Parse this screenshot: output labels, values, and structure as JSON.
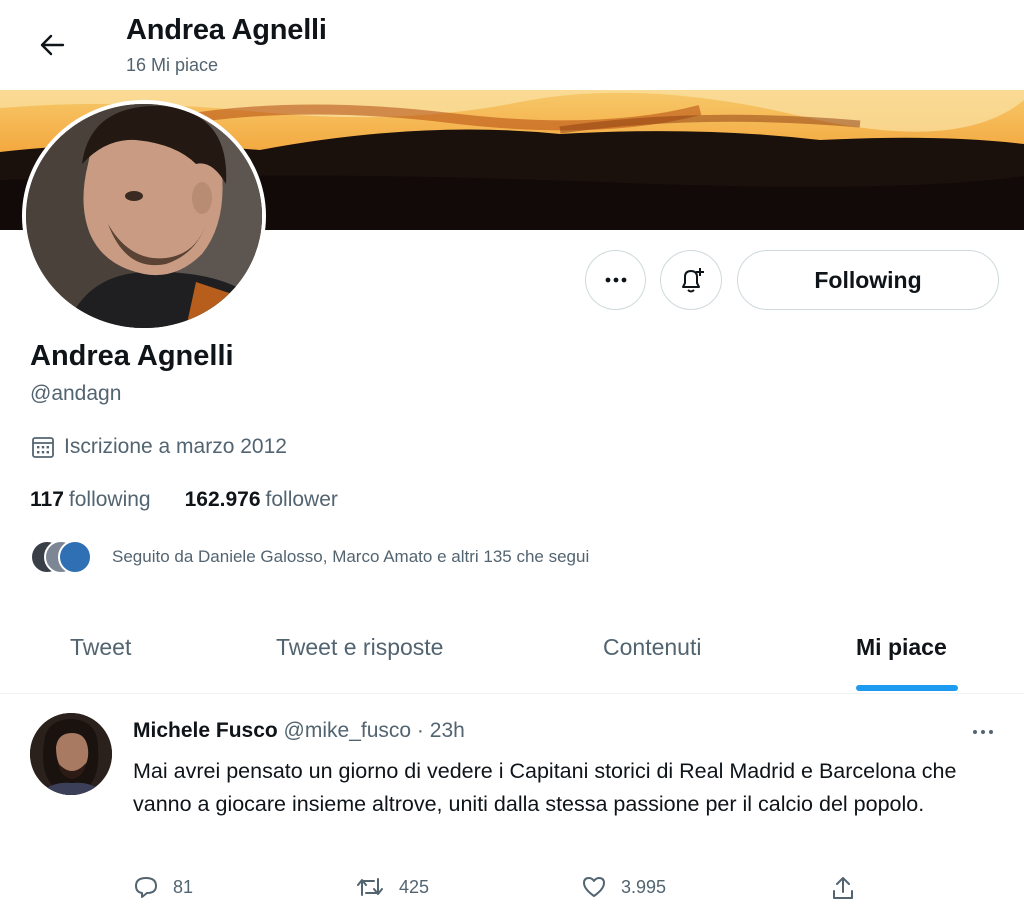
{
  "header": {
    "title": "Andrea Agnelli",
    "subtitle": "16 Mi piace"
  },
  "profile": {
    "name": "Andrea Agnelli",
    "handle": "@andagn",
    "joined": "Iscrizione a marzo 2012",
    "following_count": "117",
    "following_label": "following",
    "followers_count": "162.976",
    "followers_label": "follower",
    "followed_by": "Seguito da Daniele Galosso, Marco Amato e altri 135 che segui",
    "follow_button": "Following",
    "more_icon": "more-dots-icon",
    "bell_icon": "notification-bell-plus-icon"
  },
  "tabs": [
    {
      "label": "Tweet",
      "active": false
    },
    {
      "label": "Tweet e risposte",
      "active": false
    },
    {
      "label": "Contenuti",
      "active": false
    },
    {
      "label": "Mi piace",
      "active": true
    }
  ],
  "tweet": {
    "author": "Michele Fusco",
    "handle": "@mike_fusco",
    "separator": "·",
    "time": "23h",
    "text": "Mai avrei pensato un giorno di vedere i Capitani storici di Real Madrid e Barcelona che vanno a giocare insieme altrove, uniti dalla stessa passione per il calcio del popolo.",
    "replies": "81",
    "retweets": "425",
    "likes": "3.995"
  },
  "colors": {
    "accent": "#1d9bf0",
    "secondary_text": "#536471",
    "border": "#cfd9de"
  }
}
